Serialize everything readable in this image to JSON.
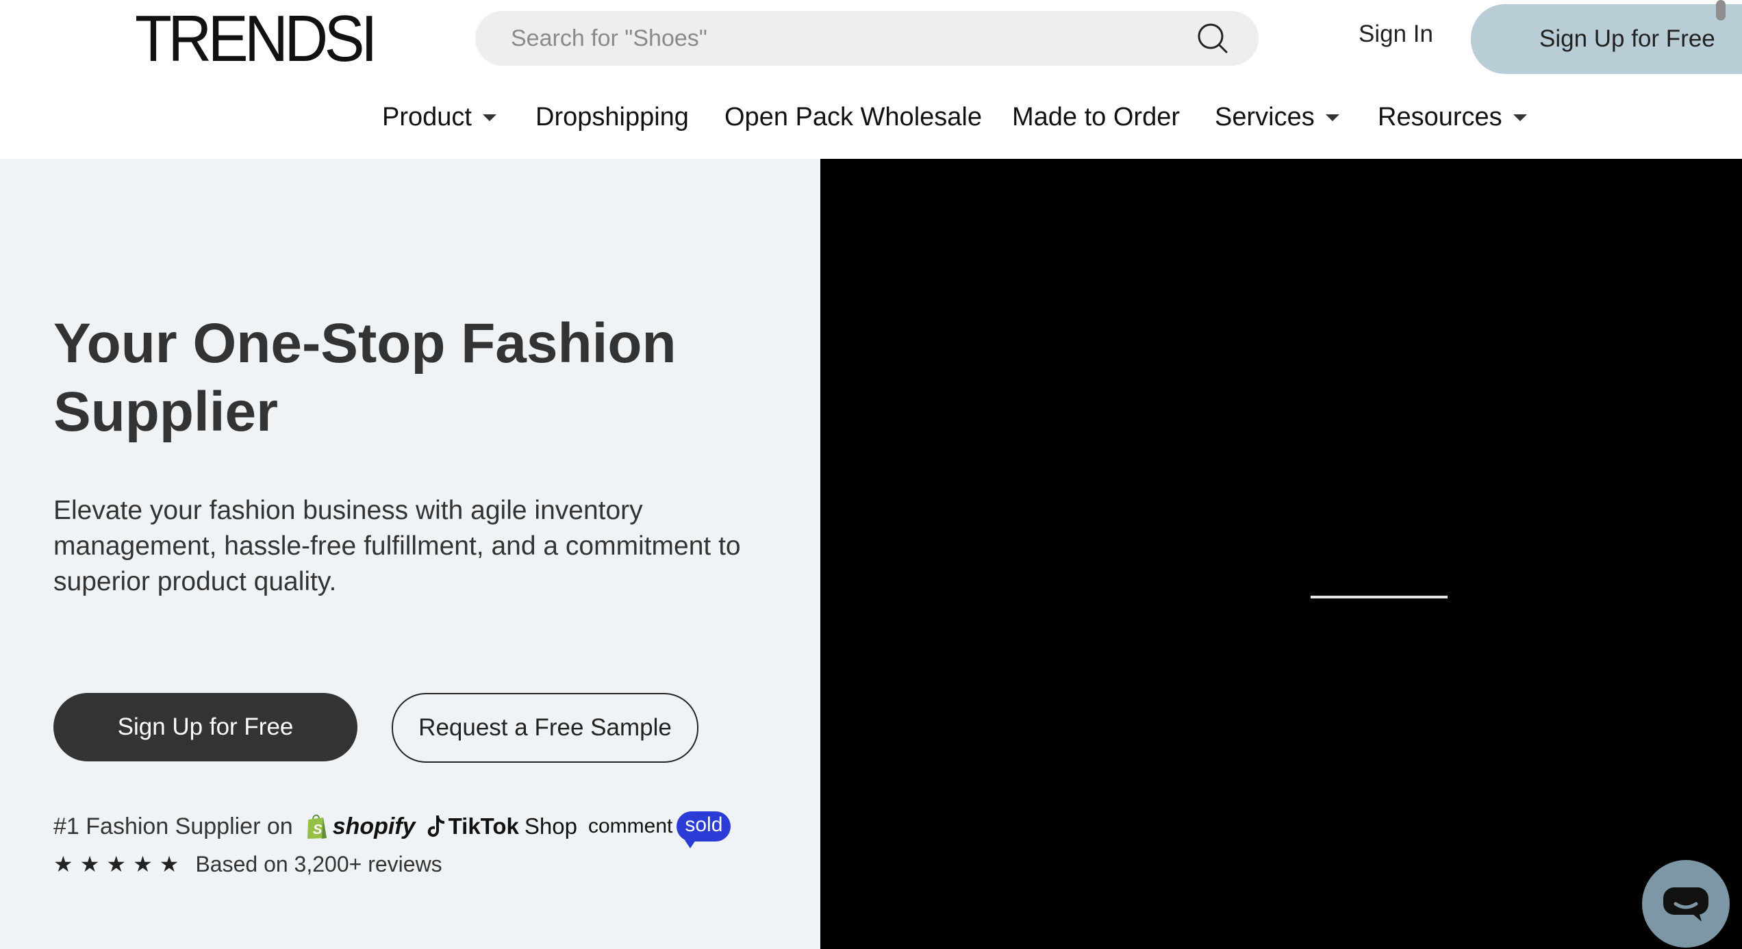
{
  "header": {
    "logo_text": "TRENDSI",
    "search_placeholder": "Search for \"Shoes\"",
    "signin_label": "Sign In",
    "signup_label": "Sign Up for Free"
  },
  "nav": {
    "items": [
      {
        "label": "Product",
        "has_dropdown": true
      },
      {
        "label": "Dropshipping",
        "has_dropdown": false
      },
      {
        "label": "Open Pack Wholesale",
        "has_dropdown": false
      },
      {
        "label": "Made to Order",
        "has_dropdown": false
      },
      {
        "label": "Services",
        "has_dropdown": true
      },
      {
        "label": "Resources",
        "has_dropdown": true
      }
    ]
  },
  "hero": {
    "headline": "Your One-Stop Fashion Supplier",
    "subtext": "Elevate your fashion business with agile inventory management, hassle-free fulfillment, and a commitment to superior product quality.",
    "primary_cta": "Sign Up for Free",
    "secondary_cta": "Request a Free Sample",
    "supplier_prefix": "#1 Fashion Supplier on",
    "partners": {
      "shopify": "shopify",
      "tiktok_brand": "TikTok",
      "tiktok_suffix": "Shop",
      "commentsold_prefix": "comment",
      "commentsold_badge": "sold"
    },
    "rating_stars": 5,
    "reviews_text": "Based on 3,200+ reviews"
  },
  "colors": {
    "signup_top_bg": "#b9cdd7",
    "hero_left_bg": "#f0f3f5",
    "primary_btn_bg": "#333333",
    "video_bg": "#000000",
    "commentsold_blue": "#2a3bd6",
    "chat_bg": "#7d97a6"
  },
  "icons": {
    "search": "search-icon",
    "caret": "chevron-down-icon",
    "star": "star-icon",
    "chat": "chat-icon"
  }
}
